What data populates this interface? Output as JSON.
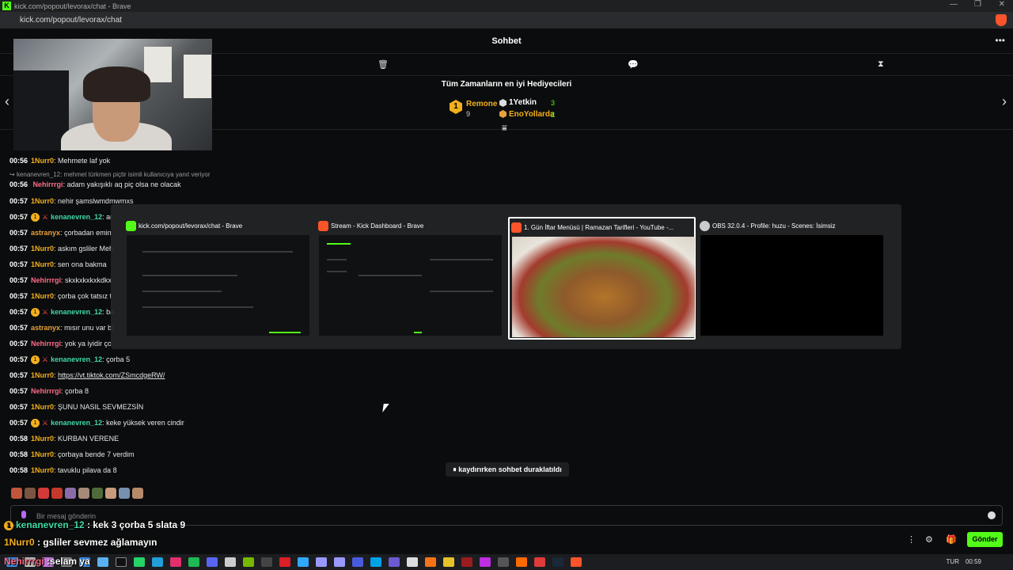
{
  "browser": {
    "window_title": "kick.com/popout/levorax/chat - Brave",
    "url": "kick.com/popout/levorax/chat"
  },
  "chat": {
    "header_title": "Sohbet",
    "top_gifters_title": "Tüm Zamanların en iyi Hediyecileri",
    "gifters": [
      {
        "rank": "1",
        "name": "Remone",
        "count": "9",
        "color": "#f2b01e"
      },
      {
        "name": "1Yetkin",
        "count": "3",
        "color": "#ffffff"
      },
      {
        "name": "EnoYollarda",
        "count": "2",
        "color": "#f2b01e"
      }
    ],
    "reply_notice": "kenanevren_12: mehmet türkmen piçtir isimli kullanıcıya yanıt veriyor",
    "messages": [
      {
        "time": "00:56",
        "user": "1Nurr0",
        "color": "#f2b01e",
        "text": ": Mehmete laf yok"
      },
      {
        "time": "00:56",
        "user": "Nehirrrgi",
        "color": "#ff6b8a",
        "text": ": adam yakışıklı aq piç olsa ne olacak"
      },
      {
        "time": "00:57",
        "user": "1Nurr0",
        "color": "#f2b01e",
        "text": ": nehir şamslwmdmwmxs"
      },
      {
        "time": "00:57",
        "user": "kenanevren_12",
        "color": "#3fd9a5",
        "text": ": ar",
        "badges": true
      },
      {
        "time": "00:57",
        "user": "astranyx",
        "color": "#e8a13b",
        "text": ": çorbadan emin"
      },
      {
        "time": "00:57",
        "user": "1Nurr0",
        "color": "#f2b01e",
        "text": ": askım gsliler Meh"
      },
      {
        "time": "00:57",
        "user": "1Nurr0",
        "color": "#f2b01e",
        "text": ": sen ona bakma"
      },
      {
        "time": "00:57",
        "user": "Nehirrrgi",
        "color": "#ff6b8a",
        "text": ": skxkxkxkxkdkx"
      },
      {
        "time": "00:57",
        "user": "1Nurr0",
        "color": "#f2b01e",
        "text": ": çorba çok tatsız t"
      },
      {
        "time": "00:57",
        "user": "kenanevren_12",
        "color": "#3fd9a5",
        "text": ": ba",
        "badges": true
      },
      {
        "time": "00:57",
        "user": "astranyx",
        "color": "#e8a13b",
        "text": ": mısır unu var bi"
      },
      {
        "time": "00:57",
        "user": "Nehirrrgi",
        "color": "#ff6b8a",
        "text": ": yok ya iyidir ço"
      },
      {
        "time": "00:57",
        "user": "kenanevren_12",
        "color": "#3fd9a5",
        "text": ": çorba 5",
        "badges": true
      },
      {
        "time": "00:57",
        "user": "1Nurr0",
        "color": "#f2b01e",
        "text": ": ",
        "link": "https://vt.tiktok.com/ZSmcdgeRW/"
      },
      {
        "time": "00:57",
        "user": "Nehirrrgi",
        "color": "#ff6b8a",
        "text": ": çorba 8"
      },
      {
        "time": "00:57",
        "user": "1Nurr0",
        "color": "#f2b01e",
        "text": ": ŞUNU NASIL SEVMEZSİN"
      },
      {
        "time": "00:57",
        "user": "kenanevren_12",
        "color": "#3fd9a5",
        "text": ": keke yüksek veren cindir",
        "badges": true
      },
      {
        "time": "00:58",
        "user": "1Nurr0",
        "color": "#f2b01e",
        "text": ": KURBAN VERENE"
      },
      {
        "time": "00:58",
        "user": "1Nurr0",
        "color": "#f2b01e",
        "text": ": çorbaya bende 7 verdim"
      },
      {
        "time": "00:58",
        "user": "1Nurr0",
        "color": "#f2b01e",
        "text": ": tavuklu pilava da 8"
      }
    ],
    "paused_label": "kaydırırken sohbet duraklatıldı",
    "input_placeholder": "Bir mesaj gönderin",
    "send_label": "Gönder"
  },
  "overlay": [
    {
      "user": "kenanevren_12",
      "color": "#3fd9a5",
      "text": " : kek 3 çorba 5 slata 9"
    },
    {
      "user": "1Nurr0",
      "color": "#f2b01e",
      "text": " : gsliler sevmez ağlamayın"
    },
    {
      "user": "Nehirrrgi",
      "color": "#ff6b8a",
      "text": " :selam ya"
    }
  ],
  "task_switcher": [
    {
      "title": "kick.com/popout/levorax/chat - Brave",
      "icon_color": "#53fc18"
    },
    {
      "title": "Stream - Kick Dashboard - Brave",
      "icon_color": "#fb542b"
    },
    {
      "title": "1. Gün İftar Menüsü | Ramazan Tarifleri - YouTube -...",
      "icon_color": "#fb542b",
      "selected": true
    },
    {
      "title": "OBS 32.0.4 - Profile: huzu - Scenes: İsimsiz",
      "icon_color": "#cccccc"
    }
  ],
  "taskbar": {
    "language": "TUR",
    "time": "00:59"
  },
  "colors": {
    "accent": "#53fc18",
    "background": "#0b0c0d"
  }
}
